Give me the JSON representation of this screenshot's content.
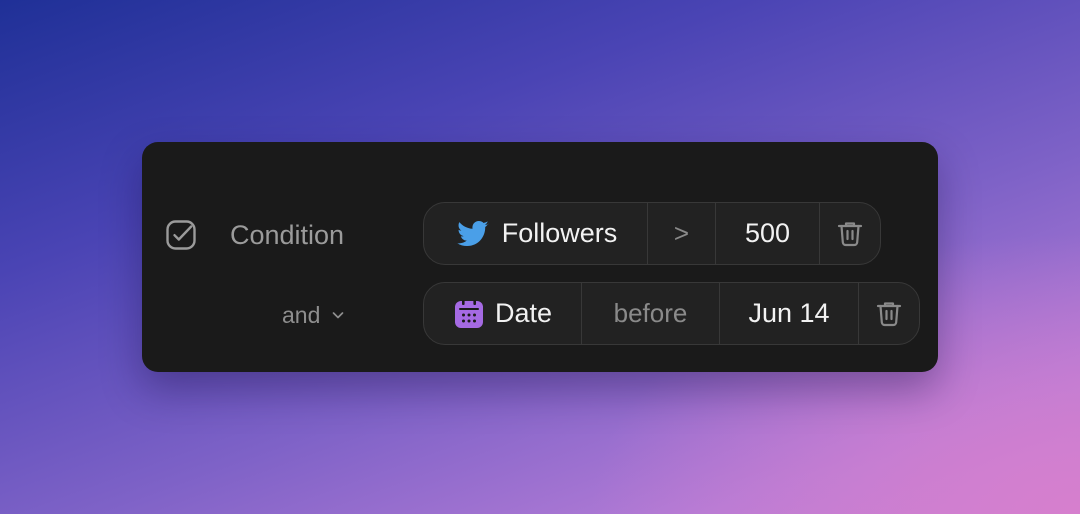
{
  "condition": {
    "label": "Condition",
    "icons": {
      "check": "checkbox-check-icon"
    }
  },
  "connector": {
    "label": "and",
    "icon": "chevron-down-icon"
  },
  "rules": [
    {
      "field": "Followers",
      "field_icon": "twitter-bird-icon",
      "operator": ">",
      "value": "500",
      "delete_icon": "trash-icon"
    },
    {
      "field": "Date",
      "field_icon": "calendar-icon",
      "operator": "before",
      "value": "Jun 14",
      "delete_icon": "trash-icon"
    }
  ],
  "colors": {
    "card_bg": "#1a1a1a",
    "pill_bg": "#222222",
    "pill_border": "#383838",
    "twitter_blue": "#4a9fe8",
    "calendar_purple": "#a56ae3",
    "primary_text": "#f2f2f2",
    "muted_text": "#8a8a8a"
  }
}
